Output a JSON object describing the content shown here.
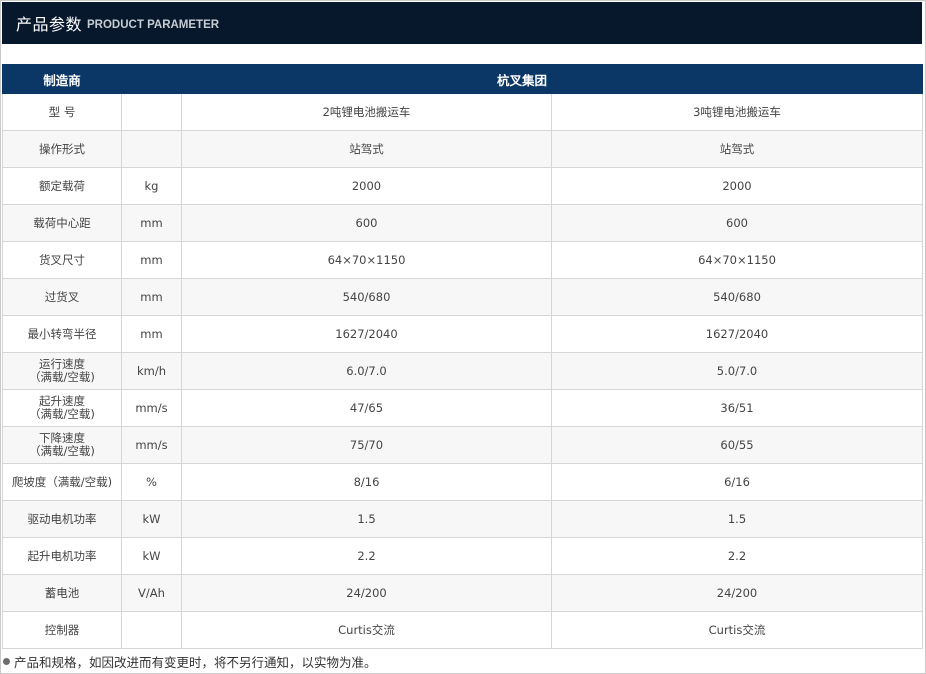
{
  "header": {
    "title_cn": "产品参数",
    "title_en": "PRODUCT PARAMETER"
  },
  "table": {
    "header": {
      "label": "制造商",
      "value": "杭叉集团"
    },
    "rows": [
      {
        "param": "型 号",
        "unit": "",
        "model_a": "2吨锂电池搬运车",
        "model_b": "3吨锂电池搬运车"
      },
      {
        "param": "操作形式",
        "unit": "",
        "model_a": "站驾式",
        "model_b": "站驾式"
      },
      {
        "param": "额定载荷",
        "unit": "kg",
        "model_a": "2000",
        "model_b": "2000"
      },
      {
        "param": "载荷中心距",
        "unit": "mm",
        "model_a": "600",
        "model_b": "600"
      },
      {
        "param": "货叉尺寸",
        "unit": "mm",
        "model_a": "64×70×1150",
        "model_b": "64×70×1150"
      },
      {
        "param": "过货叉",
        "unit": "mm",
        "model_a": "540/680",
        "model_b": "540/680"
      },
      {
        "param": "最小转弯半径",
        "unit": "mm",
        "model_a": "1627/2040",
        "model_b": "1627/2040"
      },
      {
        "param": "运行速度",
        "param_sub": "（满载/空载)",
        "unit": "km/h",
        "model_a": "6.0/7.0",
        "model_b": "5.0/7.0"
      },
      {
        "param": "起升速度",
        "param_sub": "（满载/空载)",
        "unit": "mm/s",
        "model_a": "47/65",
        "model_b": "36/51"
      },
      {
        "param": "下降速度",
        "param_sub": "（满载/空载)",
        "unit": "mm/s",
        "model_a": "75/70",
        "model_b": "60/55"
      },
      {
        "param": "爬坡度（满载/空载)",
        "unit": "%",
        "model_a": "8/16",
        "model_b": "6/16"
      },
      {
        "param": "驱动电机功率",
        "unit": "kW",
        "model_a": "1.5",
        "model_b": "1.5"
      },
      {
        "param": "起升电机功率",
        "unit": "kW",
        "model_a": "2.2",
        "model_b": "2.2"
      },
      {
        "param": "蓄电池",
        "unit": "V/Ah",
        "model_a": "24/200",
        "model_b": "24/200"
      },
      {
        "param": "控制器",
        "unit": "",
        "model_a": "Curtis交流",
        "model_b": "Curtis交流"
      }
    ]
  },
  "footnote": {
    "icon": "bullet-dot",
    "text": "产品和规格，如因改进而有变更时，将不另行通知，以实物为准。"
  }
}
